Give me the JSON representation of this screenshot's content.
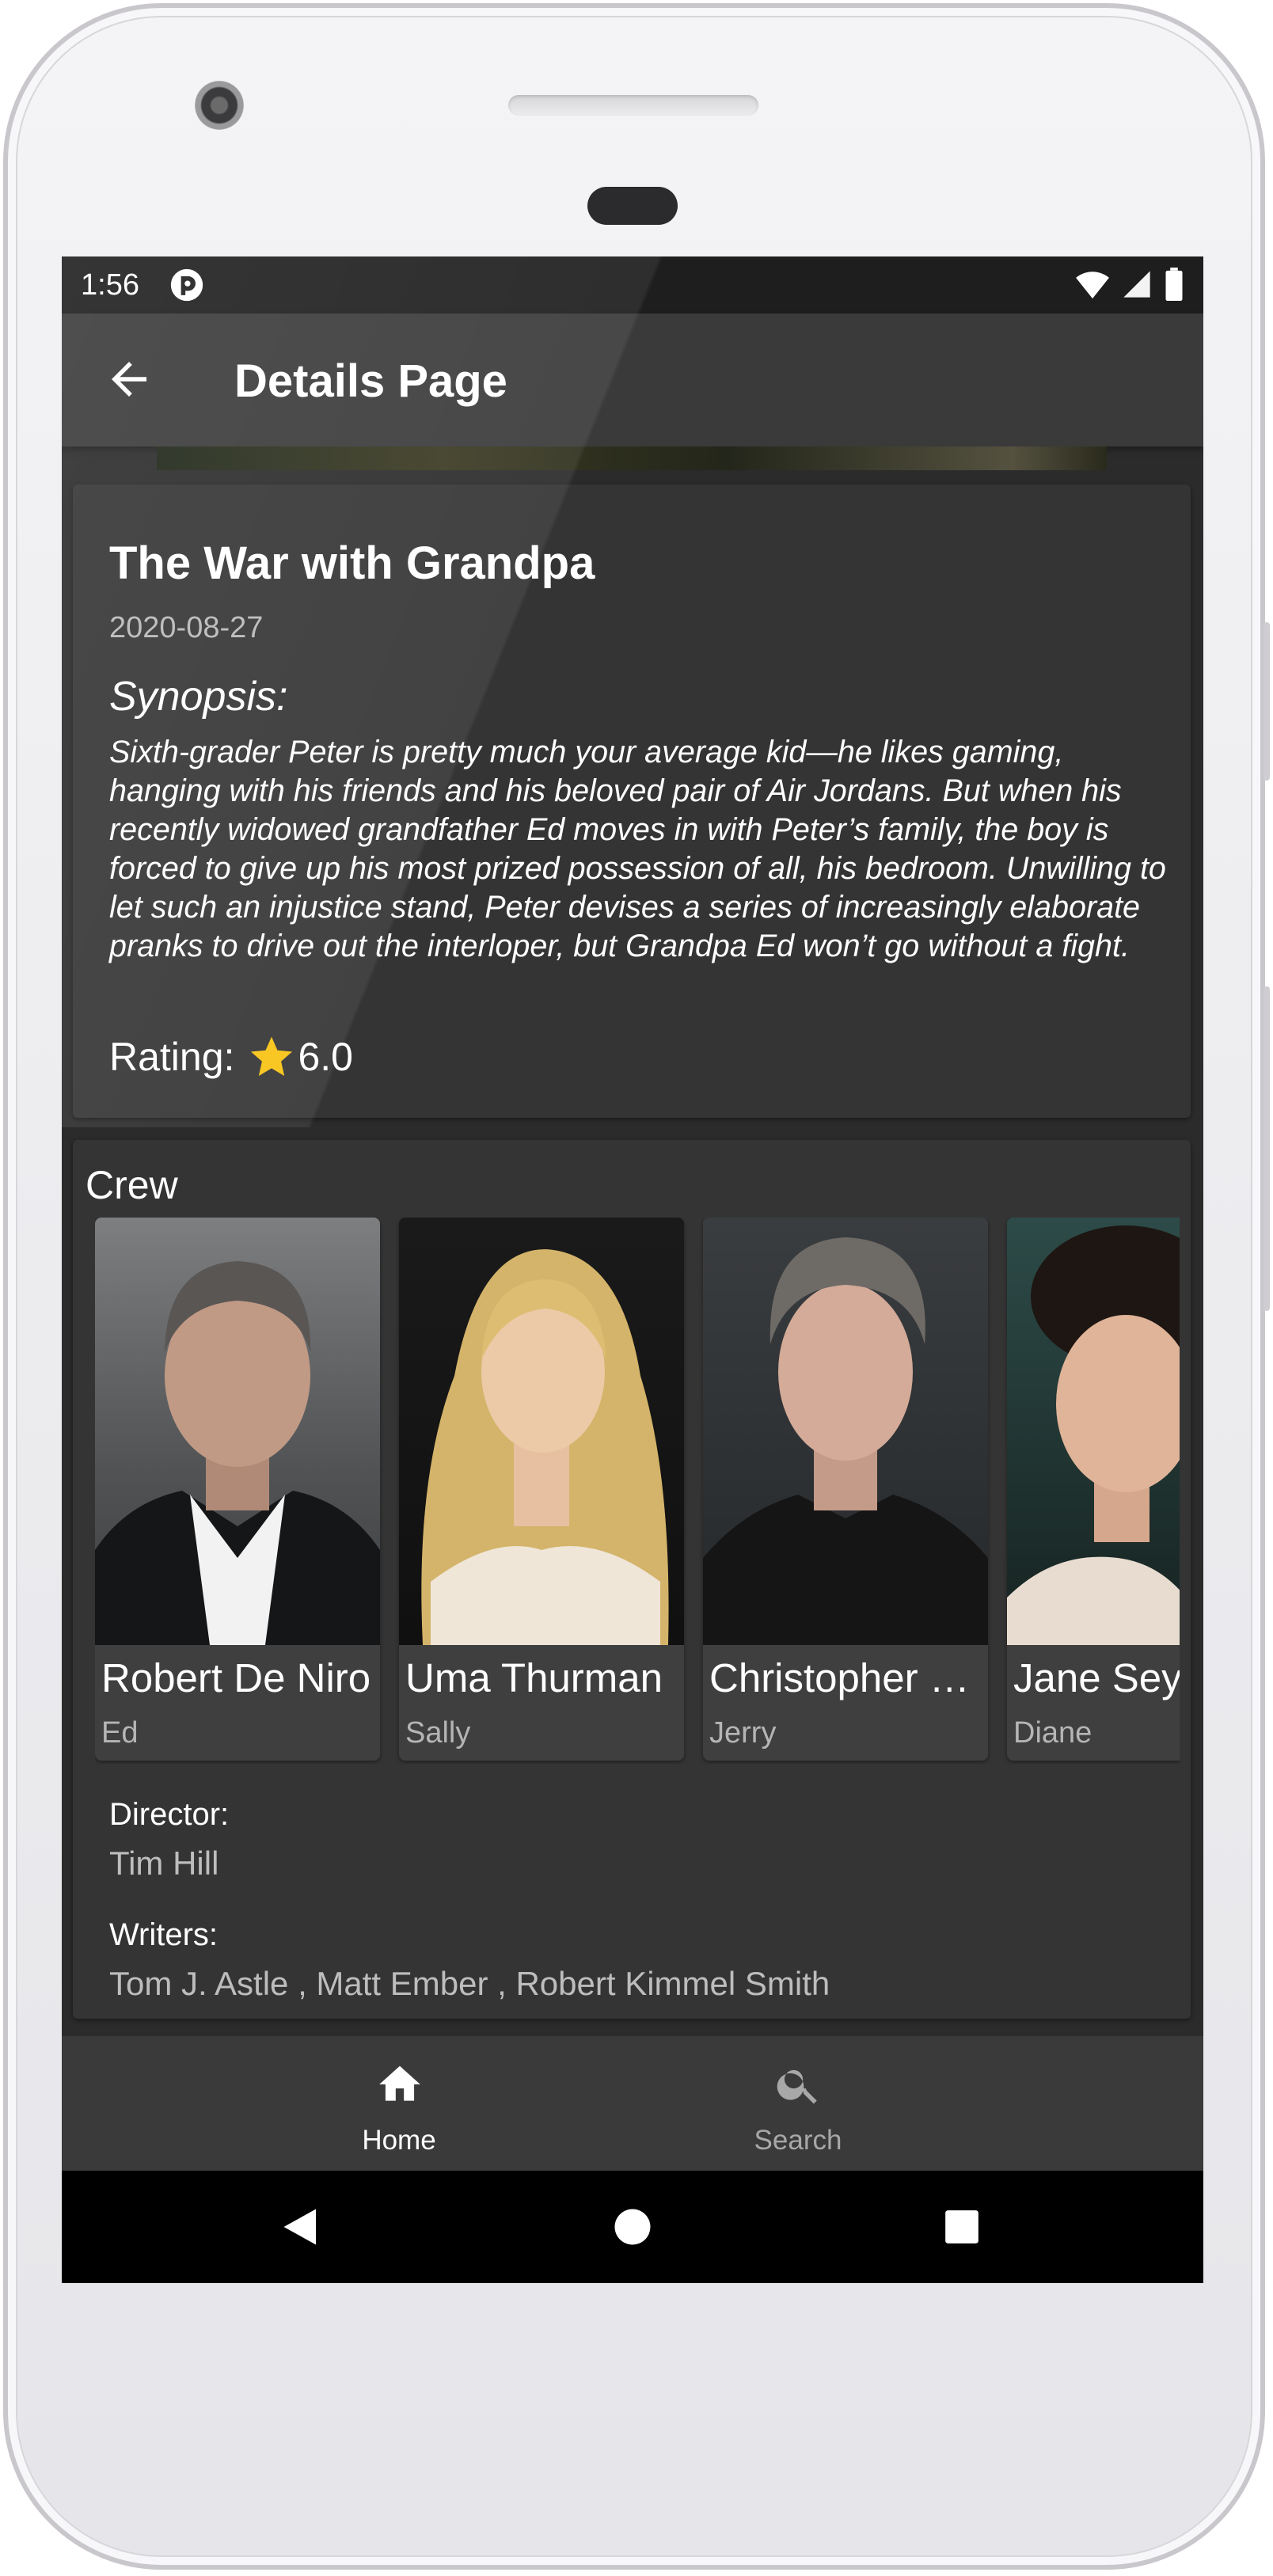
{
  "status_bar": {
    "time": "1:56"
  },
  "app_bar": {
    "title": "Details Page"
  },
  "movie": {
    "title": "The War with Grandpa",
    "release_date": "2020-08-27",
    "synopsis_label": "Synopsis:",
    "synopsis": "Sixth-grader Peter is pretty much your average kid—he likes gaming, hanging with his friends and his beloved pair of Air Jordans. But when his recently widowed grandfather Ed moves in with Peter’s family, the boy is forced to give up his most prized possession of all, his bedroom. Unwilling to let such an injustice stand, Peter devises a series of increasingly elaborate pranks to drive out the interloper, but Grandpa Ed won’t go without a fight.",
    "rating_label": "Rating:",
    "rating_value": "6.0"
  },
  "crew": {
    "title": "Crew",
    "people": [
      {
        "name": "Robert De Niro",
        "role": "Ed"
      },
      {
        "name": "Uma Thurman",
        "role": "Sally"
      },
      {
        "name": "Christopher Walken",
        "role": "Jerry"
      },
      {
        "name": "Jane Seymour",
        "role": "Diane"
      }
    ],
    "director_label": "Director:",
    "director": "Tim Hill",
    "writers_label": "Writers:",
    "writers": "Tom J. Astle , Matt Ember , Robert Kimmel Smith"
  },
  "bottom_nav": {
    "items": [
      {
        "label": "Home",
        "icon": "home-icon",
        "active": true
      },
      {
        "label": "Search",
        "icon": "search-icon",
        "active": false
      }
    ]
  },
  "colors": {
    "background": "#2b2b2b",
    "card": "#343434",
    "app_bar": "#3a3a3a",
    "star": "#f9c313",
    "secondary_text": "#b9b9b9"
  }
}
